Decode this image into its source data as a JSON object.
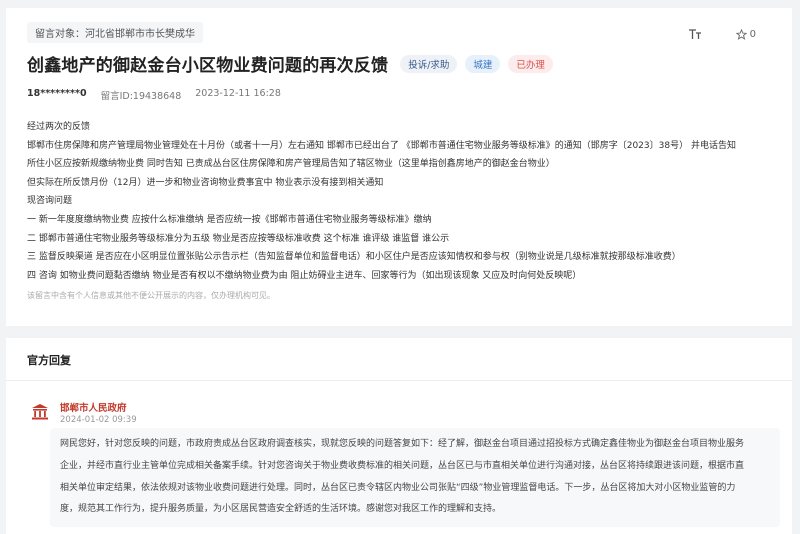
{
  "question": {
    "target_tag": "留言对象：河北省邯郸市市长樊成华",
    "font_icon_label": "T",
    "star_count": "0",
    "title": "创鑫地产的御赵金台小区物业费问题的再次反馈",
    "badges": [
      "投诉/求助",
      "城建",
      "已办理"
    ],
    "author": "18********0",
    "message_id": "留言ID:19438648",
    "datetime": "2023-12-11 16:28",
    "body": [
      "经过两次的反馈",
      "邯郸市住房保障和房产管理局物业管理处在十月份（或者十一月）左右通知 邯郸市已经出台了 《邯郸市普通住宅物业服务等级标准》的通知（邯房字〔2023〕38号） 并电话告知",
      "所住小区应按新规缴纳物业费 同时告知 已责成丛台区住房保障和房产管理局告知了辖区物业（这里单指创鑫房地产的御赵金台物业）",
      "但实际在所反馈月份（12月）进一步和物业咨询物业费事宜中 物业表示没有接到相关通知",
      "现咨询问题",
      "一 新一年度度缴纳物业费 应按什么标准缴纳 是否应统一按《邯郸市普通住宅物业服务等级标准》缴纳",
      "二 邯郸市普通住宅物业服务等级标准分为五级 物业是否应按等级标准收费 这个标准 谁评级 谁监督 谁公示",
      "三 监督反映渠道 是否应在小区明显位置张贴公示告示栏（告知监督单位和监督电话）和小区住户是否应该知情权和参与权（别物业说是几级标准就按那级标准收费）",
      "四 咨询 如物业费问题黏否缴纳 物业是否有权以不缴纳物业费为由 阻止妨碍业主进车、回家等行为（如出现该现象 又应及时向何处反映呢）"
    ],
    "disclaimer": "该留言中含有个人信息或其他不便公开展示的内容，仅办理机构可见。"
  },
  "reply": {
    "section_title": "官方回复",
    "department": "邯郸市人民政府",
    "datetime": "2024-01-02 09:39",
    "body": [
      "网民您好，针对您反映的问题，市政府责成丛台区政府调查核实，现就您反映的问题答复如下：经了解，御赵金台项目通过招投标方式确定鑫佳物业为御赵金台项目物业服务",
      "企业，并经市直行业主管单位完成相关备案手续。针对您咨询关于物业费收费标准的相关问题，丛台区已与市直相关单位进行沟通对接，丛台区将持续跟进该问题，根据市直",
      "相关单位审定结果，依法依规对该物业收费问题进行处理。同时，丛台区已责令辖区内物业公司张贴“四级”物业管理监督电话。下一步，丛台区将加大对小区物业监管的力",
      "度，规范其工作行为，提升服务质量，为小区居民营造安全舒适的生活环境。感谢您对我区工作的理解和支持。"
    ]
  },
  "colors": {
    "badge_status": "#d9534f",
    "badge_category": "#3b79c4",
    "department": "#c23a2b"
  }
}
